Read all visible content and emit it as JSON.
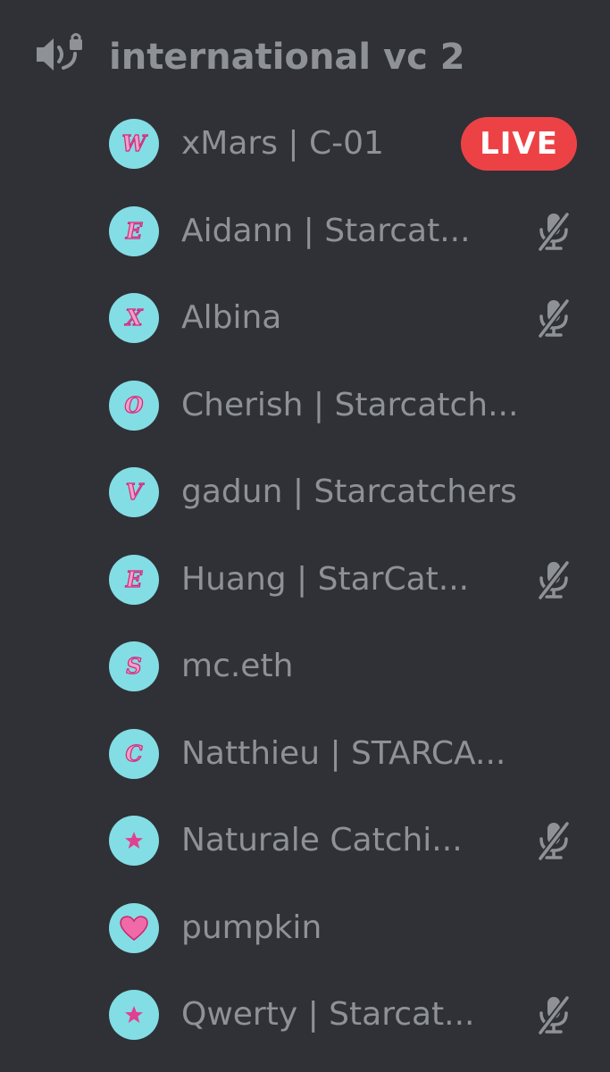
{
  "channel": {
    "name": "international vc 2",
    "icon": "locked-speaker-icon"
  },
  "colors": {
    "background": "#2f3136",
    "text_muted": "#8e9297",
    "avatar_bg": "#83dde5",
    "avatar_glyph": "#e0408f",
    "live": "#ed4245"
  },
  "users": [
    {
      "name": "xMars | C-01",
      "avatar": "W",
      "live": "LIVE",
      "muted": false
    },
    {
      "name": "Aidann | Starcat...",
      "avatar": "E",
      "muted": true
    },
    {
      "name": "Albina",
      "avatar": "X",
      "muted": true
    },
    {
      "name": "Cherish | Starcatch...",
      "avatar": "O",
      "muted": false
    },
    {
      "name": "gadun | Starcatchers",
      "avatar": "V",
      "muted": false
    },
    {
      "name": "Huang | StarCat...",
      "avatar": "E",
      "muted": true
    },
    {
      "name": "mc.eth",
      "avatar": "S",
      "muted": false
    },
    {
      "name": "Natthieu | STARCA...",
      "avatar": "C",
      "muted": false
    },
    {
      "name": "Naturale Catchi...",
      "avatar": "star-icon",
      "muted": true
    },
    {
      "name": "pumpkin",
      "avatar": "heart-icon",
      "muted": false
    },
    {
      "name": "Qwerty | Starcat...",
      "avatar": "star-icon",
      "muted": true
    }
  ]
}
